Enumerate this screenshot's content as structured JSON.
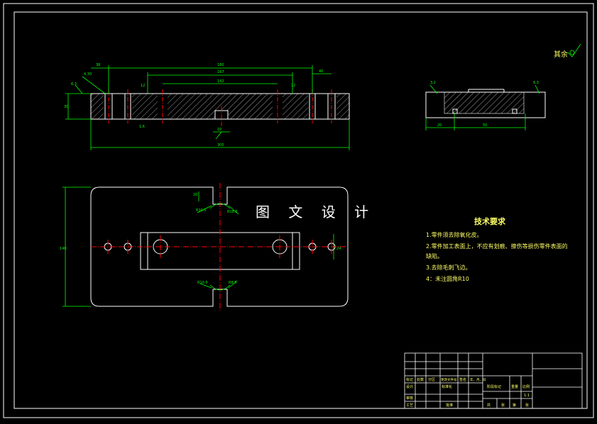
{
  "watermark": "图 文 设 计",
  "roughness_note": "其余",
  "tech_req": {
    "title": "技术要求",
    "items": [
      "1.零件须去除氧化皮。",
      "2.零件加工表面上，不应有划痕、擦伤等损伤零件表面的",
      "缺陷。",
      "3.去除毛刺飞边。",
      "4：未注圆角R10"
    ]
  },
  "dims_front": {
    "overall_width": "300",
    "top_span": "180",
    "inner_span": "167",
    "inner_mid": "142",
    "left_offset": "38",
    "right_offset": "40",
    "height": "30",
    "slot_small_left": "12",
    "slot_small_right": "12",
    "chamfer_left": "4.30",
    "rough_left": "6.3",
    "rough_mid": "1.6",
    "bottom_slot": "10"
  },
  "dims_side": {
    "left": "3.2",
    "right": "6.3",
    "bottom_left": "20",
    "bottom_right": "50"
  },
  "dims_plan": {
    "height": "140",
    "slot_width": "20",
    "radius_top_left": "R10.5",
    "radius_top_right": "R18.5",
    "radius_bot_left": "R10.5",
    "radius_bot_right": "R8.5",
    "right_mark": "24"
  },
  "title_block": {
    "rows": [
      "标记",
      "处数",
      "分区",
      "更改文件号",
      "签名",
      "年、月、日"
    ],
    "designer": "设计",
    "check": "审核",
    "process": "工艺",
    "standard": "标准化",
    "approve": "批准",
    "stage": "阶段标记",
    "weight": "重量",
    "scale": "比例",
    "scale_value": "1:1",
    "sheets": [
      "共",
      "张",
      "第",
      "张"
    ]
  },
  "colors": {
    "frame": "#ffffff",
    "dimension": "#00ff00",
    "centerline": "#ff0000",
    "text_yellow": "#ffff66"
  }
}
